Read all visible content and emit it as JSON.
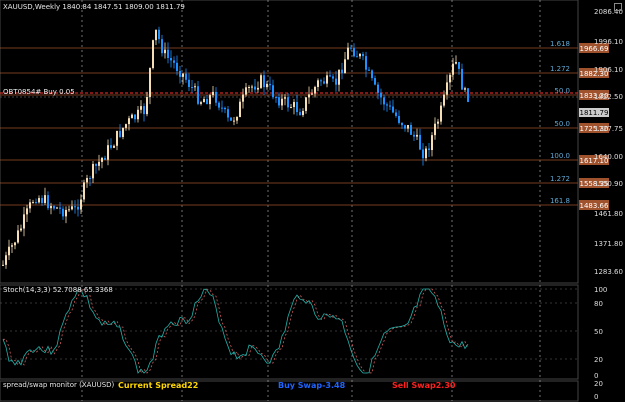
{
  "header": {
    "symbol_label": "XAUUSD,Weekly",
    "ohlc": "1840.84 1847.51 1809.00 1811.79"
  },
  "price_axis": {
    "labels": [
      "2086.40",
      "1996.10",
      "1906.10",
      "1822.50",
      "1727.75",
      "1640.00",
      "1550.90",
      "1461.80",
      "1371.80",
      "1283.60"
    ]
  },
  "fib_levels": [
    {
      "ratio": "1.618",
      "price": "1966.69"
    },
    {
      "ratio": "1.272",
      "price": "1882.30"
    },
    {
      "ratio": "50.0",
      "price": "1833.30"
    },
    {
      "ratio": "50.0",
      "price": "1725.30"
    },
    {
      "ratio": "100.0",
      "price": "1617.10"
    },
    {
      "ratio": "1.272",
      "price": "1558.35"
    },
    {
      "ratio": "161.8",
      "price": "1483.66"
    }
  ],
  "current_price_tag": "1811.79",
  "overlay_text": "OBT0854# Buy 0.05",
  "stoch": {
    "label": "Stoch(14,3,3) 52.7088 65.3368",
    "axis": [
      "100",
      "80",
      "50",
      "20",
      "0"
    ]
  },
  "spread_panel": {
    "label": "spread/swap monitor (XAUUSD)",
    "current_spread_label": "Current Spread",
    "current_spread_value": "22",
    "buy_swap_label": "Buy Swap",
    "buy_swap_value": "-3.48",
    "sell_swap_label": "Sell Swap",
    "sell_swap_value": "2.30",
    "axis": [
      "20",
      "0"
    ]
  },
  "colors": {
    "background": "#000000",
    "bull_candle": "#f5deb3",
    "bear_candle": "#1e90ff",
    "fib_line": "#a0522d",
    "stoch_main": "#20b2aa",
    "stoch_signal": "#cd5c5c",
    "spread_yellow": "#ffd700",
    "buy_swap_blue": "#1e64ff",
    "sell_swap_red": "#ff2020"
  }
}
